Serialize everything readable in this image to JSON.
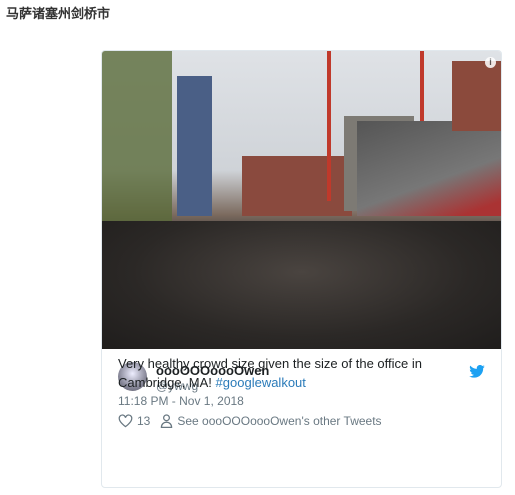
{
  "page": {
    "title": "马萨诸塞州剑桥市"
  },
  "tweet": {
    "author_name": "oooOOOoooOwen",
    "handle": "@ywwg",
    "text": "Very healthy crowd size given the size of the office in Cambridge, MA! ",
    "hashtag": "#googlewalkout",
    "timestamp": "11:18 PM - Nov 1, 2018",
    "likes": "13",
    "see_other": "See oooOOOoooOwen's other Tweets",
    "info_icon": "i",
    "colors": {
      "link": "#2b7bb9",
      "bird": "#1da1f2"
    }
  }
}
